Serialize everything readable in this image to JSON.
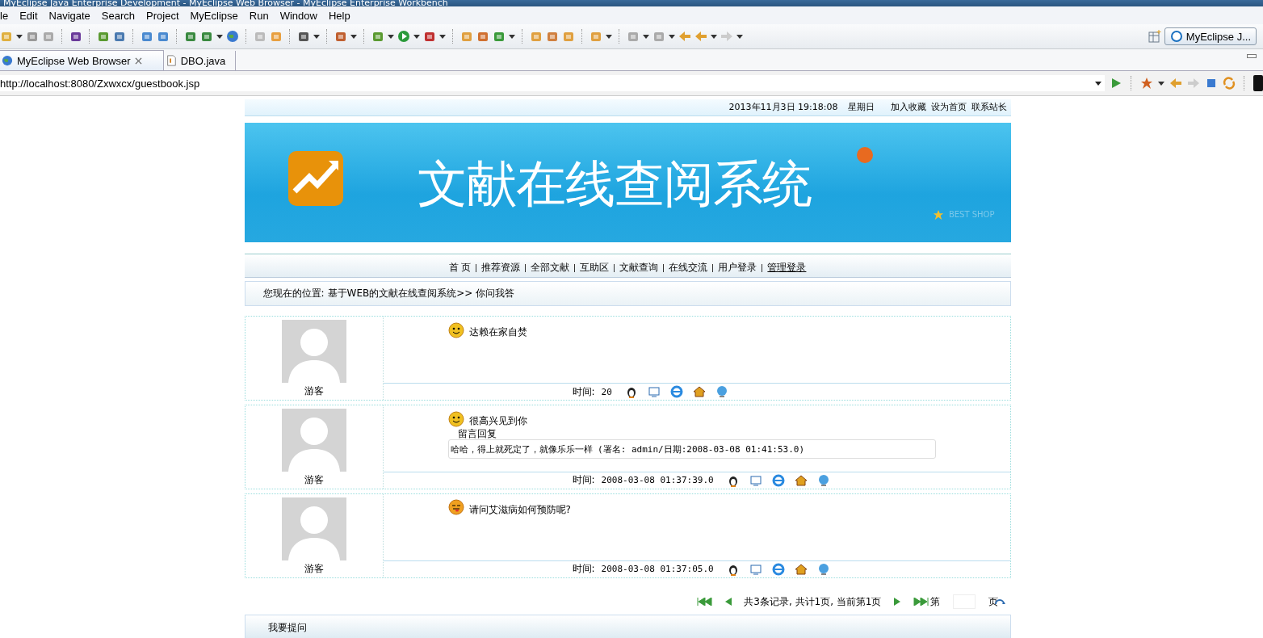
{
  "window": {
    "title": "MyEclipse Java Enterprise Development - MyEclipse Web Browser - MyEclipse Enterprise Workbench"
  },
  "menu": [
    "le",
    "Edit",
    "Navigate",
    "Search",
    "Project",
    "MyEclipse",
    "Run",
    "Window",
    "Help"
  ],
  "perspective": {
    "label": "MyEclipse J..."
  },
  "editor_tabs": [
    {
      "label": "MyEclipse Web Browser",
      "selected": true,
      "kind": "browser"
    },
    {
      "label": "DBO.java",
      "selected": false,
      "kind": "java"
    }
  ],
  "url": "http://localhost:8080/Zxwxcx/guestbook.jsp",
  "page": {
    "top_bar": {
      "datetime": "2013年11月3日 19:18:08",
      "weekday": "星期日",
      "links": [
        "加入收藏",
        "设为首页",
        "联系站长"
      ]
    },
    "banner": {
      "title": "文献在线查阅系统",
      "tagline": "BEST SHOP"
    },
    "nav": [
      {
        "label": "首 页",
        "underlined": false
      },
      {
        "label": "推荐资源",
        "underlined": false
      },
      {
        "label": "全部文献",
        "underlined": false
      },
      {
        "label": "互助区",
        "underlined": false
      },
      {
        "label": "文献查询",
        "underlined": false
      },
      {
        "label": "在线交流",
        "underlined": false
      },
      {
        "label": "用户登录",
        "underlined": false
      },
      {
        "label": "管理登录",
        "underlined": true
      }
    ],
    "breadcrumb": {
      "label": "您现在的位置:",
      "path": "基于WEB的文献在线查阅系统>>",
      "current": "你问我答"
    },
    "messages": [
      {
        "author": "游客",
        "kind": "smile",
        "title": "达赖在家自焚",
        "time_label": "时间:",
        "time": "20"
      },
      {
        "author": "游客",
        "kind": "smile",
        "title": "很高兴见到你",
        "reply": {
          "heading": "留言回复",
          "text": "哈哈，得上就死定了，就像乐乐一样 (署名: admin/日期:2008-03-08 01:41:53.0)"
        },
        "time_label": "时间:",
        "time": "2008-03-08 01:37:39.0"
      },
      {
        "author": "游客",
        "kind": "tongue",
        "title": "请问艾滋病如何预防呢?",
        "time_label": "时间:",
        "time": "2008-03-08 01:37:05.0"
      }
    ],
    "pager": {
      "summary": "共3条记录, 共计1页, 当前第1页",
      "page_prefix": "第",
      "page_suffix": "页"
    },
    "ask_bar": "我要提问"
  }
}
